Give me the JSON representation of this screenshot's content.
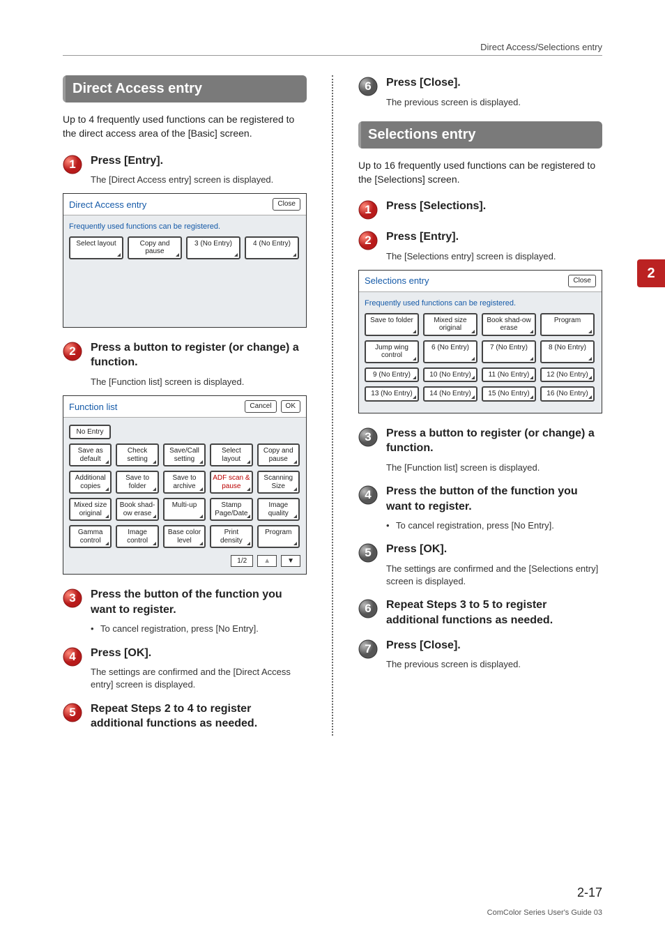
{
  "running_head": "Direct Access/Selections entry",
  "side_tab": "2",
  "page_number": "2-17",
  "footer": "ComColor Series User's Guide 03",
  "left": {
    "section_title": "Direct Access entry",
    "lead": "Up to 4 frequently used functions can be registered to the direct access area of the [Basic] screen.",
    "steps": {
      "s1": {
        "num": "1",
        "title": "Press [Entry].",
        "desc": "The [Direct Access entry] screen is displayed."
      },
      "s2": {
        "num": "2",
        "title": "Press a button to register (or change) a function.",
        "desc": "The [Function list] screen is displayed."
      },
      "s3": {
        "num": "3",
        "title": "Press the button of the function you want to register.",
        "bullet": "To cancel registration, press [No Entry]."
      },
      "s4": {
        "num": "4",
        "title": "Press [OK].",
        "desc": "The settings are confirmed and the [Direct Access entry] screen is displayed."
      },
      "s5": {
        "num": "5",
        "title": "Repeat Steps 2 to 4 to register additional functions as needed."
      }
    },
    "mock_da": {
      "title": "Direct Access entry",
      "close": "Close",
      "note": "Frequently used functions can be registered.",
      "buttons": [
        "Select layout",
        "Copy and pause",
        "3\n(No Entry)",
        "4\n(No Entry)"
      ]
    },
    "mock_fl": {
      "title": "Function list",
      "cancel": "Cancel",
      "ok": "OK",
      "no_entry": "No Entry",
      "rows": [
        [
          "Save as default",
          "Check setting",
          "Save/Call setting",
          "Select layout",
          "Copy and pause"
        ],
        [
          "Additional copies",
          "Save to folder",
          "Save to archive",
          "ADF scan & pause",
          "Scanning Size"
        ],
        [
          "Mixed size original",
          "Book shad-ow erase",
          "Multi-up",
          "Stamp Page/Date",
          "Image quality"
        ],
        [
          "Gamma control",
          "Image control",
          "Base color level",
          "Print density",
          "Program"
        ]
      ],
      "pager": "1/2",
      "up": "▲",
      "down": "▼"
    }
  },
  "right": {
    "s6_top": {
      "num": "6",
      "title": "Press [Close].",
      "desc": "The previous screen is displayed."
    },
    "section_title": "Selections entry",
    "lead": "Up to 16 frequently used functions can be registered to the [Selections] screen.",
    "steps": {
      "s1": {
        "num": "1",
        "title": "Press [Selections]."
      },
      "s2": {
        "num": "2",
        "title": "Press [Entry].",
        "desc": "The [Selections entry] screen is displayed."
      },
      "s3": {
        "num": "3",
        "title": "Press a button to register (or change) a function.",
        "desc": "The [Function list] screen is displayed."
      },
      "s4": {
        "num": "4",
        "title": "Press the button of the function you want to register.",
        "bullet": "To cancel registration, press [No Entry]."
      },
      "s5": {
        "num": "5",
        "title": "Press [OK].",
        "desc": "The settings are confirmed and the [Selections entry] screen is displayed."
      },
      "s6": {
        "num": "6",
        "title": "Repeat Steps 3 to 5 to register additional functions as needed."
      },
      "s7": {
        "num": "7",
        "title": "Press [Close].",
        "desc": "The previous screen is displayed."
      }
    },
    "mock_se": {
      "title": "Selections entry",
      "close": "Close",
      "note": "Frequently used functions can be registered.",
      "rows": [
        [
          "Save to folder",
          "Mixed size original",
          "Book shad-ow erase",
          "Program"
        ],
        [
          "Jump wing control",
          "6\n(No Entry)",
          "7\n(No Entry)",
          "8\n(No Entry)"
        ],
        [
          "9\n(No Entry)",
          "10\n(No Entry)",
          "11\n(No Entry)",
          "12\n(No Entry)"
        ],
        [
          "13\n(No Entry)",
          "14\n(No Entry)",
          "15\n(No Entry)",
          "16\n(No Entry)"
        ]
      ]
    }
  }
}
